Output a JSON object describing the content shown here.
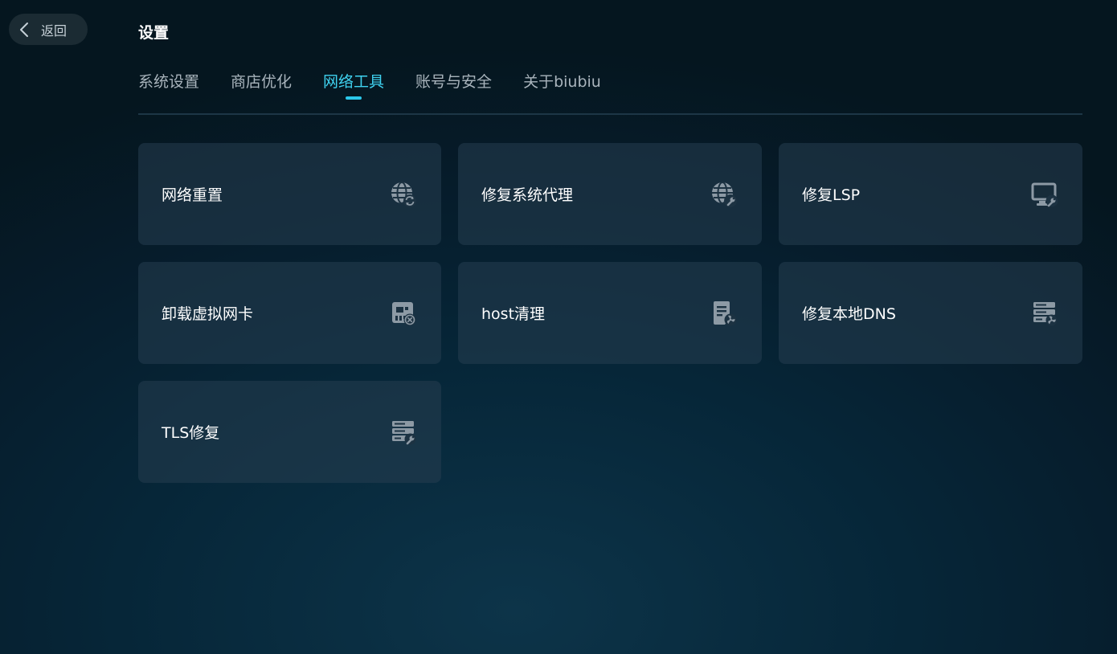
{
  "header": {
    "back_label": "返回",
    "title": "设置"
  },
  "tabs": [
    {
      "label": "系统设置",
      "active": false
    },
    {
      "label": "商店优化",
      "active": false
    },
    {
      "label": "网络工具",
      "active": true
    },
    {
      "label": "账号与安全",
      "active": false
    },
    {
      "label": "关于biubiu",
      "active": false
    }
  ],
  "tools": [
    {
      "label": "网络重置",
      "icon": "globe-refresh-icon"
    },
    {
      "label": "修复系统代理",
      "icon": "globe-wrench-icon"
    },
    {
      "label": "修复LSP",
      "icon": "monitor-wrench-icon"
    },
    {
      "label": "卸载虚拟网卡",
      "icon": "network-card-remove-icon"
    },
    {
      "label": "host清理",
      "icon": "document-fan-icon"
    },
    {
      "label": "修复本地DNS",
      "icon": "server-fan-icon"
    },
    {
      "label": "TLS修复",
      "icon": "server-wrench-icon"
    }
  ],
  "colors": {
    "accent": "#3fd2f0",
    "icon": "#8d9aa5"
  }
}
